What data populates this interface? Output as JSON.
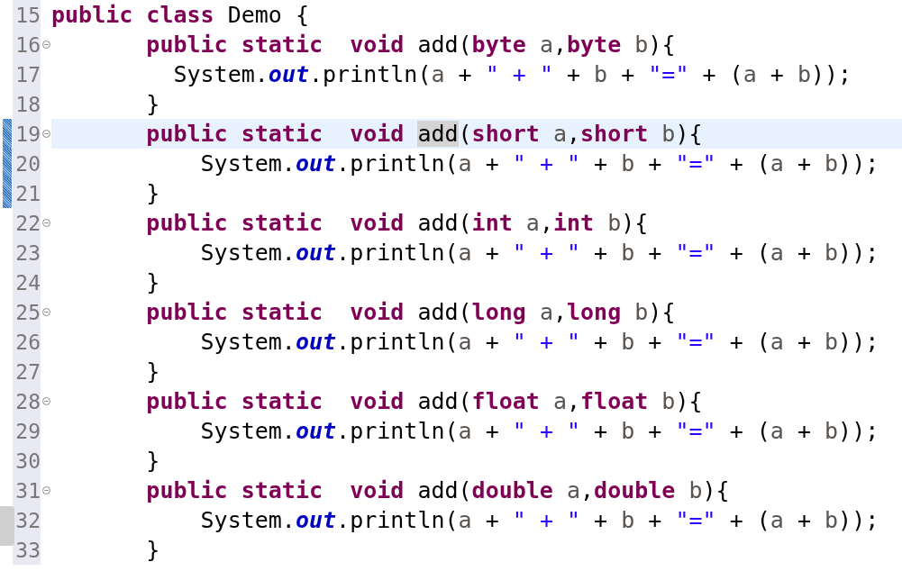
{
  "editor": {
    "lines": [
      {
        "number": "15",
        "fold": false,
        "current": false,
        "changed": false,
        "tokens": [
          {
            "kind": "keyword",
            "text": "public class"
          },
          {
            "kind": "plain",
            "text": " Demo {"
          }
        ]
      },
      {
        "number": "16",
        "fold": true,
        "current": false,
        "changed": false,
        "tokens": [
          {
            "kind": "keyword",
            "text": "       public static  void"
          },
          {
            "kind": "plain",
            "text": " add("
          },
          {
            "kind": "keyword",
            "text": "byte "
          },
          {
            "kind": "param",
            "text": "a"
          },
          {
            "kind": "plain",
            "text": ","
          },
          {
            "kind": "keyword",
            "text": "byte "
          },
          {
            "kind": "param",
            "text": "b"
          },
          {
            "kind": "plain",
            "text": "){"
          }
        ]
      },
      {
        "number": "17",
        "fold": false,
        "current": false,
        "changed": false,
        "tokens": [
          {
            "kind": "plain",
            "text": "         System."
          },
          {
            "kind": "field",
            "text": "out"
          },
          {
            "kind": "plain",
            "text": ".println("
          },
          {
            "kind": "param",
            "text": "a"
          },
          {
            "kind": "plain",
            "text": " + "
          },
          {
            "kind": "string",
            "text": "\" + \""
          },
          {
            "kind": "plain",
            "text": " + "
          },
          {
            "kind": "param",
            "text": "b"
          },
          {
            "kind": "plain",
            "text": " + "
          },
          {
            "kind": "string",
            "text": "\"=\""
          },
          {
            "kind": "plain",
            "text": " + ("
          },
          {
            "kind": "param",
            "text": "a"
          },
          {
            "kind": "plain",
            "text": " + "
          },
          {
            "kind": "param",
            "text": "b"
          },
          {
            "kind": "plain",
            "text": "));"
          }
        ]
      },
      {
        "number": "18",
        "fold": false,
        "current": false,
        "changed": false,
        "tokens": [
          {
            "kind": "plain",
            "text": "       }"
          }
        ]
      },
      {
        "number": "19",
        "fold": true,
        "current": true,
        "changed": true,
        "tokens": [
          {
            "kind": "keyword",
            "text": "       public static  void "
          },
          {
            "kind": "plain",
            "text": "add",
            "highlighted": true
          },
          {
            "kind": "plain",
            "text": "("
          },
          {
            "kind": "keyword",
            "text": "short "
          },
          {
            "kind": "param",
            "text": "a"
          },
          {
            "kind": "plain",
            "text": ","
          },
          {
            "kind": "keyword",
            "text": "short "
          },
          {
            "kind": "param",
            "text": "b"
          },
          {
            "kind": "plain",
            "text": "){"
          }
        ]
      },
      {
        "number": "20",
        "fold": false,
        "current": false,
        "changed": true,
        "tokens": [
          {
            "kind": "plain",
            "text": "           System."
          },
          {
            "kind": "field",
            "text": "out"
          },
          {
            "kind": "plain",
            "text": ".println("
          },
          {
            "kind": "param",
            "text": "a"
          },
          {
            "kind": "plain",
            "text": " + "
          },
          {
            "kind": "string",
            "text": "\" + \""
          },
          {
            "kind": "plain",
            "text": " + "
          },
          {
            "kind": "param",
            "text": "b"
          },
          {
            "kind": "plain",
            "text": " + "
          },
          {
            "kind": "string",
            "text": "\"=\""
          },
          {
            "kind": "plain",
            "text": " + ("
          },
          {
            "kind": "param",
            "text": "a"
          },
          {
            "kind": "plain",
            "text": " + "
          },
          {
            "kind": "param",
            "text": "b"
          },
          {
            "kind": "plain",
            "text": "));"
          }
        ]
      },
      {
        "number": "21",
        "fold": false,
        "current": false,
        "changed": true,
        "tokens": [
          {
            "kind": "plain",
            "text": "       }"
          }
        ]
      },
      {
        "number": "22",
        "fold": true,
        "current": false,
        "changed": false,
        "tokens": [
          {
            "kind": "keyword",
            "text": "       public static  void"
          },
          {
            "kind": "plain",
            "text": " add("
          },
          {
            "kind": "keyword",
            "text": "int "
          },
          {
            "kind": "param",
            "text": "a"
          },
          {
            "kind": "plain",
            "text": ","
          },
          {
            "kind": "keyword",
            "text": "int "
          },
          {
            "kind": "param",
            "text": "b"
          },
          {
            "kind": "plain",
            "text": "){"
          }
        ]
      },
      {
        "number": "23",
        "fold": false,
        "current": false,
        "changed": false,
        "tokens": [
          {
            "kind": "plain",
            "text": "           System."
          },
          {
            "kind": "field",
            "text": "out"
          },
          {
            "kind": "plain",
            "text": ".println("
          },
          {
            "kind": "param",
            "text": "a"
          },
          {
            "kind": "plain",
            "text": " + "
          },
          {
            "kind": "string",
            "text": "\" + \""
          },
          {
            "kind": "plain",
            "text": " + "
          },
          {
            "kind": "param",
            "text": "b"
          },
          {
            "kind": "plain",
            "text": " + "
          },
          {
            "kind": "string",
            "text": "\"=\""
          },
          {
            "kind": "plain",
            "text": " + ("
          },
          {
            "kind": "param",
            "text": "a"
          },
          {
            "kind": "plain",
            "text": " + "
          },
          {
            "kind": "param",
            "text": "b"
          },
          {
            "kind": "plain",
            "text": "));"
          }
        ]
      },
      {
        "number": "24",
        "fold": false,
        "current": false,
        "changed": false,
        "tokens": [
          {
            "kind": "plain",
            "text": "       }"
          }
        ]
      },
      {
        "number": "25",
        "fold": true,
        "current": false,
        "changed": false,
        "tokens": [
          {
            "kind": "keyword",
            "text": "       public static  void"
          },
          {
            "kind": "plain",
            "text": " add("
          },
          {
            "kind": "keyword",
            "text": "long "
          },
          {
            "kind": "param",
            "text": "a"
          },
          {
            "kind": "plain",
            "text": ","
          },
          {
            "kind": "keyword",
            "text": "long "
          },
          {
            "kind": "param",
            "text": "b"
          },
          {
            "kind": "plain",
            "text": "){"
          }
        ]
      },
      {
        "number": "26",
        "fold": false,
        "current": false,
        "changed": false,
        "tokens": [
          {
            "kind": "plain",
            "text": "           System."
          },
          {
            "kind": "field",
            "text": "out"
          },
          {
            "kind": "plain",
            "text": ".println("
          },
          {
            "kind": "param",
            "text": "a"
          },
          {
            "kind": "plain",
            "text": " + "
          },
          {
            "kind": "string",
            "text": "\" + \""
          },
          {
            "kind": "plain",
            "text": " + "
          },
          {
            "kind": "param",
            "text": "b"
          },
          {
            "kind": "plain",
            "text": " + "
          },
          {
            "kind": "string",
            "text": "\"=\""
          },
          {
            "kind": "plain",
            "text": " + ("
          },
          {
            "kind": "param",
            "text": "a"
          },
          {
            "kind": "plain",
            "text": " + "
          },
          {
            "kind": "param",
            "text": "b"
          },
          {
            "kind": "plain",
            "text": "));"
          }
        ]
      },
      {
        "number": "27",
        "fold": false,
        "current": false,
        "changed": false,
        "tokens": [
          {
            "kind": "plain",
            "text": "       }"
          }
        ]
      },
      {
        "number": "28",
        "fold": true,
        "current": false,
        "changed": false,
        "tokens": [
          {
            "kind": "keyword",
            "text": "       public static  void"
          },
          {
            "kind": "plain",
            "text": " add("
          },
          {
            "kind": "keyword",
            "text": "float "
          },
          {
            "kind": "param",
            "text": "a"
          },
          {
            "kind": "plain",
            "text": ","
          },
          {
            "kind": "keyword",
            "text": "float "
          },
          {
            "kind": "param",
            "text": "b"
          },
          {
            "kind": "plain",
            "text": "){"
          }
        ]
      },
      {
        "number": "29",
        "fold": false,
        "current": false,
        "changed": false,
        "tokens": [
          {
            "kind": "plain",
            "text": "           System."
          },
          {
            "kind": "field",
            "text": "out"
          },
          {
            "kind": "plain",
            "text": ".println("
          },
          {
            "kind": "param",
            "text": "a"
          },
          {
            "kind": "plain",
            "text": " + "
          },
          {
            "kind": "string",
            "text": "\" + \""
          },
          {
            "kind": "plain",
            "text": " + "
          },
          {
            "kind": "param",
            "text": "b"
          },
          {
            "kind": "plain",
            "text": " + "
          },
          {
            "kind": "string",
            "text": "\"=\""
          },
          {
            "kind": "plain",
            "text": " + ("
          },
          {
            "kind": "param",
            "text": "a"
          },
          {
            "kind": "plain",
            "text": " + "
          },
          {
            "kind": "param",
            "text": "b"
          },
          {
            "kind": "plain",
            "text": "));"
          }
        ]
      },
      {
        "number": "30",
        "fold": false,
        "current": false,
        "changed": false,
        "tokens": [
          {
            "kind": "plain",
            "text": "       }"
          }
        ]
      },
      {
        "number": "31",
        "fold": true,
        "current": false,
        "changed": false,
        "tokens": [
          {
            "kind": "keyword",
            "text": "       public static  void"
          },
          {
            "kind": "plain",
            "text": " add("
          },
          {
            "kind": "keyword",
            "text": "double "
          },
          {
            "kind": "param",
            "text": "a"
          },
          {
            "kind": "plain",
            "text": ","
          },
          {
            "kind": "keyword",
            "text": "double "
          },
          {
            "kind": "param",
            "text": "b"
          },
          {
            "kind": "plain",
            "text": "){"
          }
        ]
      },
      {
        "number": "32",
        "fold": false,
        "current": false,
        "changed": false,
        "tokens": [
          {
            "kind": "plain",
            "text": "           System."
          },
          {
            "kind": "field",
            "text": "out"
          },
          {
            "kind": "plain",
            "text": ".println("
          },
          {
            "kind": "param",
            "text": "a"
          },
          {
            "kind": "plain",
            "text": " + "
          },
          {
            "kind": "string",
            "text": "\" + \""
          },
          {
            "kind": "plain",
            "text": " + "
          },
          {
            "kind": "param",
            "text": "b"
          },
          {
            "kind": "plain",
            "text": " + "
          },
          {
            "kind": "string",
            "text": "\"=\""
          },
          {
            "kind": "plain",
            "text": " + ("
          },
          {
            "kind": "param",
            "text": "a"
          },
          {
            "kind": "plain",
            "text": " + "
          },
          {
            "kind": "param",
            "text": "b"
          },
          {
            "kind": "plain",
            "text": "));"
          }
        ]
      },
      {
        "number": "33",
        "fold": false,
        "current": false,
        "changed": false,
        "tokens": [
          {
            "kind": "plain",
            "text": "       }"
          }
        ]
      }
    ]
  }
}
